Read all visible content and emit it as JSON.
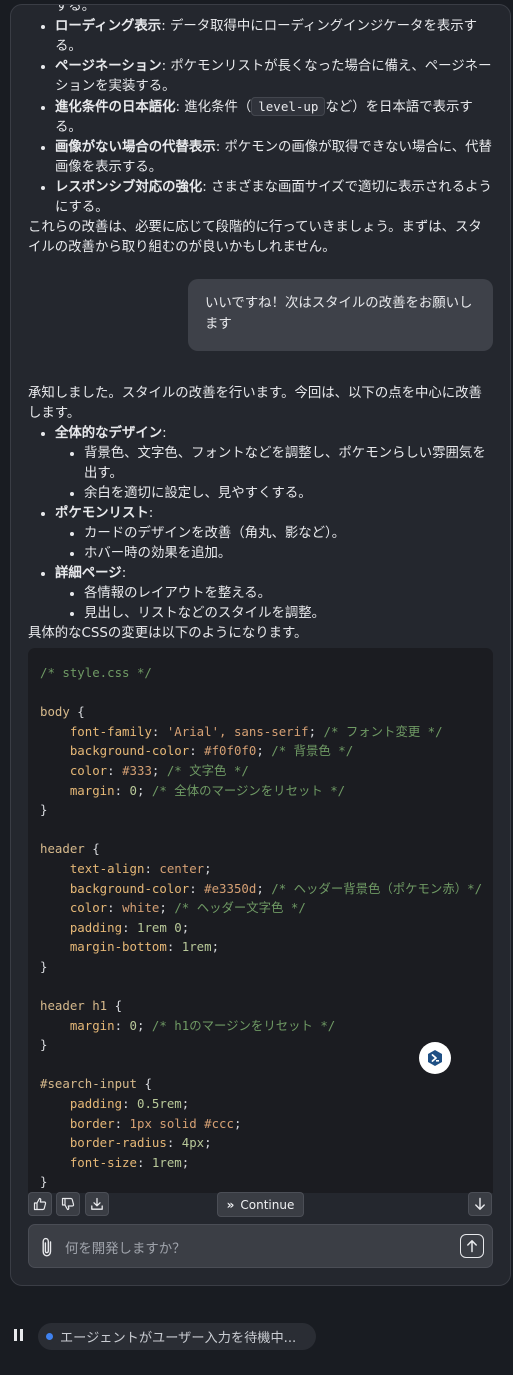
{
  "assistant_1": {
    "items": [
      {
        "bold": "",
        "text": "する。"
      },
      {
        "bold": "ローディング表示",
        "text": ": データ取得中にローディングインジケータを表示する。"
      },
      {
        "bold": "ページネーション",
        "text": ": ポケモンリストが長くなった場合に備え、ページネーションを実装する。"
      },
      {
        "bold": "進化条件の日本語化",
        "text_a": ": 進化条件（",
        "code": "level-up",
        "text_b": "など）を日本語で表示する。"
      },
      {
        "bold": "画像がない場合の代替表示",
        "text": ": ポケモンの画像が取得できない場合に、代替画像を表示する。"
      },
      {
        "bold": "レスポンシブ対応の強化",
        "text": ": さまざまな画面サイズで適切に表示されるようにする。"
      }
    ],
    "closing": "これらの改善は、必要に応じて段階的に行っていきましょう。まずは、スタイルの改善から取り組むのが良いかもしれません。"
  },
  "user_message": "いいですね！次はスタイルの改善をお願いします",
  "assistant_2": {
    "intro": "承知しました。スタイルの改善を行います。今回は、以下の点を中心に改善します。",
    "sections": [
      {
        "title": "全体的なデザイン",
        "items": [
          "背景色、文字色、フォントなどを調整し、ポケモンらしい雰囲気を出す。",
          "余白を適切に設定し、見やすくする。"
        ]
      },
      {
        "title": "ポケモンリスト",
        "items": [
          "カードのデザインを改善（角丸、影など）。",
          "ホバー時の効果を追加。"
        ]
      },
      {
        "title": "詳細ページ",
        "items": [
          "各情報のレイアウトを整える。",
          "見出し、リストなどのスタイルを調整。"
        ]
      }
    ],
    "outro": "具体的なCSSの変更は以下のようになります。"
  },
  "code": {
    "comment_file": "/* style.css */",
    "body_sel": "body",
    "body_rules": [
      {
        "prop": "font-family",
        "val": "'Arial', sans-serif",
        "cm": "/* フォント変更 */"
      },
      {
        "prop": "background-color",
        "val": "#f0f0f0",
        "cm": "/* 背景色 */"
      },
      {
        "prop": "color",
        "val": "#333",
        "cm": "/* 文字色 */"
      },
      {
        "prop": "margin",
        "val": "0",
        "cm": "/* 全体のマージンをリセット */"
      }
    ],
    "header_sel": "header",
    "header_rules": [
      {
        "prop": "text-align",
        "val": "center",
        "cm": ""
      },
      {
        "prop": "background-color",
        "val": "#e3350d",
        "cm": "/* ヘッダー背景色（ポケモン赤）*/"
      },
      {
        "prop": "color",
        "val": "white",
        "cm": "/* ヘッダー文字色 */"
      },
      {
        "prop": "padding",
        "val": "1rem 0",
        "cm": ""
      },
      {
        "prop": "margin-bottom",
        "val": "1rem",
        "cm": ""
      }
    ],
    "h1_sel": "header h1",
    "h1_rules": [
      {
        "prop": "margin",
        "val": "0",
        "cm": "/* h1のマージンをリセット */"
      }
    ],
    "search_sel": "#search-input",
    "search_rules": [
      {
        "prop": "padding",
        "val": "0.5rem",
        "cm": ""
      },
      {
        "prop": "border",
        "val": "1px solid #ccc",
        "cm": ""
      },
      {
        "prop": "border-radius",
        "val": "4px",
        "cm": ""
      },
      {
        "prop": "font-size",
        "val": "1rem",
        "cm": ""
      }
    ]
  },
  "toolbar": {
    "continue_label": "Continue"
  },
  "input": {
    "placeholder": "何を開発しますか？"
  },
  "status": {
    "text": "エージェントがユーザー入力を待機中..."
  },
  "colors": {
    "status_dot": "#3f82f0",
    "panel": "#24272e",
    "code_bg": "#1b1c21"
  }
}
